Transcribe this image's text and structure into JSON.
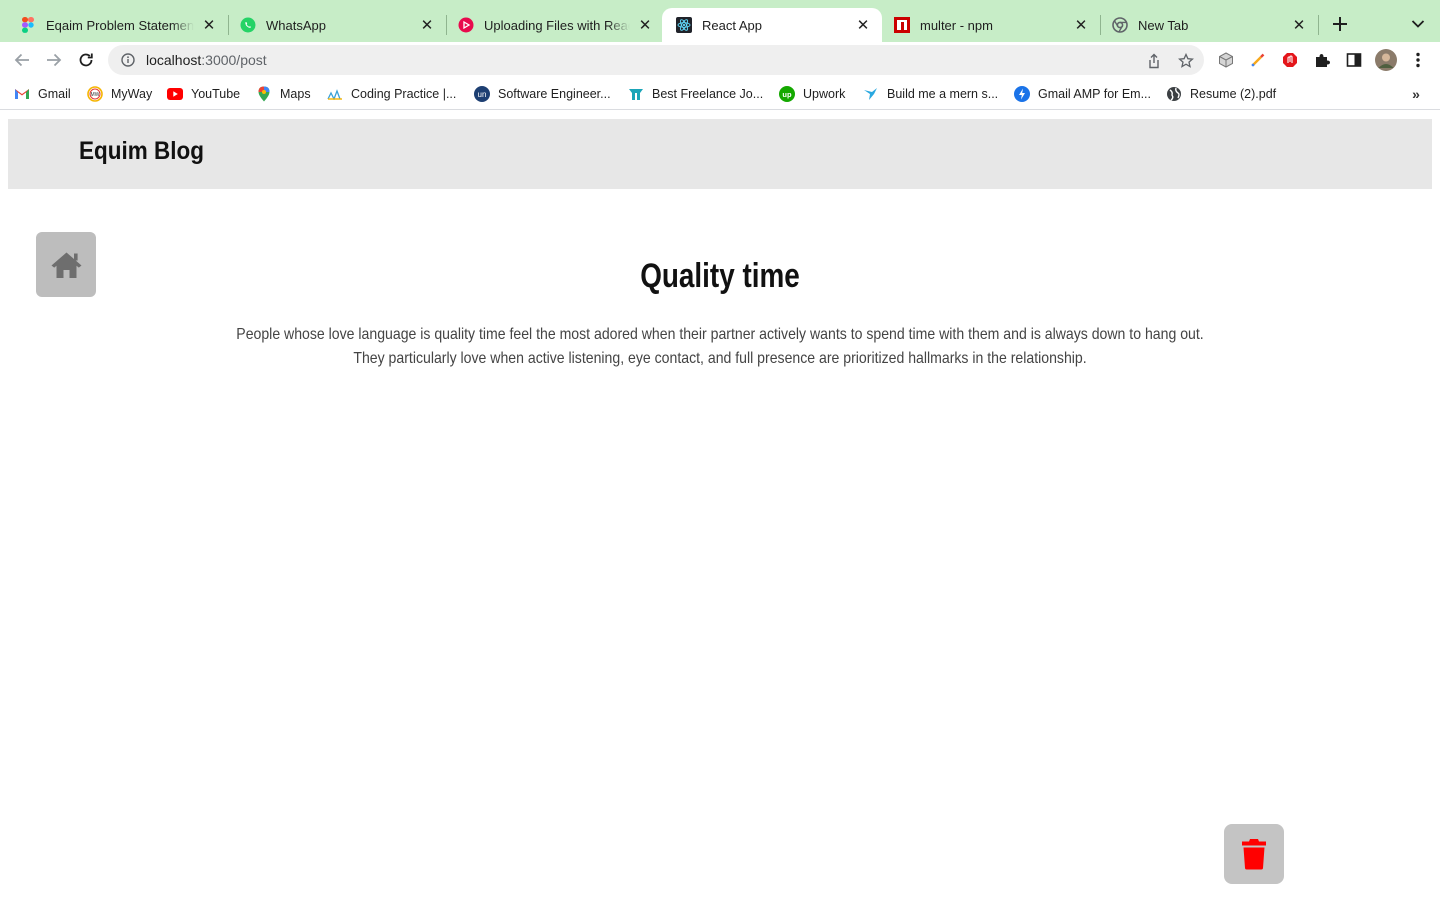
{
  "browser": {
    "tabs": [
      {
        "label": "Eqaim Problem Statement - ",
        "icon": "figma-icon",
        "active": false
      },
      {
        "label": "WhatsApp",
        "icon": "whatsapp-icon",
        "active": false
      },
      {
        "label": "Uploading Files with React.",
        "icon": "pluralsight-icon",
        "active": false
      },
      {
        "label": "React App",
        "icon": "react-icon",
        "active": true
      },
      {
        "label": "multer - npm",
        "icon": "npm-icon",
        "active": false
      },
      {
        "label": "New Tab",
        "icon": "chrome-icon",
        "active": false
      }
    ],
    "address": {
      "host": "localhost",
      "path": ":3000/post"
    },
    "bookmarks": [
      {
        "label": "Gmail",
        "icon": "gmail-icon"
      },
      {
        "label": "MyWay",
        "icon": "myway-icon"
      },
      {
        "label": "YouTube",
        "icon": "youtube-icon"
      },
      {
        "label": "Maps",
        "icon": "maps-icon"
      },
      {
        "label": "Coding Practice |...",
        "icon": "coding-practice-icon"
      },
      {
        "label": "Software Engineer...",
        "icon": "un-icon"
      },
      {
        "label": "Best Freelance Jo...",
        "icon": "freelance-icon"
      },
      {
        "label": "Upwork",
        "icon": "upwork-icon"
      },
      {
        "label": "Build me a mern s...",
        "icon": "bird-icon"
      },
      {
        "label": "Gmail AMP for Em...",
        "icon": "amp-icon"
      },
      {
        "label": "Resume (2).pdf",
        "icon": "globe-icon"
      }
    ],
    "more_bookmarks": "»"
  },
  "app": {
    "brand": "Equim Blog",
    "post": {
      "title": "Quality time",
      "body": "People whose love language is quality time feel the most adored when their partner actively wants to spend time with them and is always down to hang out. They particularly love when active listening, eye contact, and full presence are prioritized hallmarks in the relationship."
    },
    "colors": {
      "header_bg": "#e7e7e7",
      "button_bg": "#bdbdbd",
      "home_icon": "#6e6e6e",
      "delete_icon": "#ff0000",
      "tabstrip_bg": "#c7edc7"
    }
  }
}
